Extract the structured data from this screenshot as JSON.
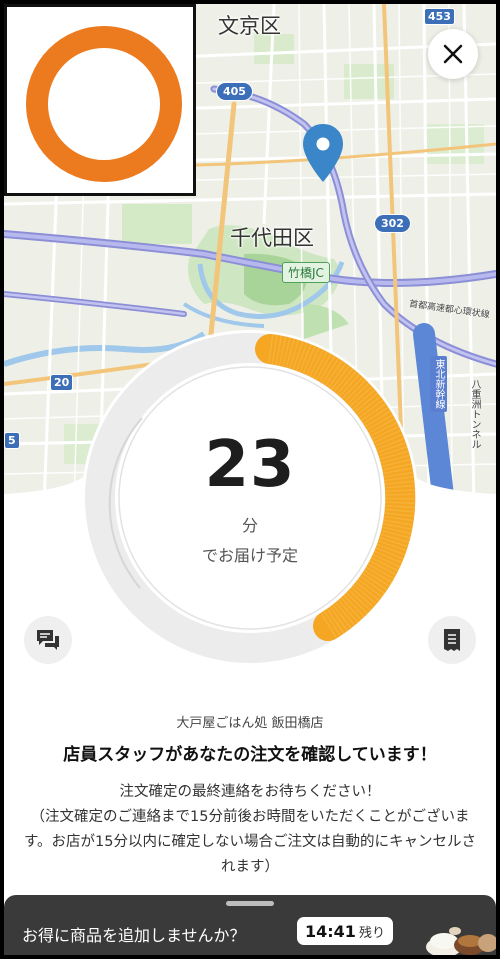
{
  "map": {
    "labels": {
      "bunkyo": "文京区",
      "chiyoda": "千代田区",
      "takebashi_jc": "竹橋JC",
      "shutoko": "首都高速都心環状線",
      "tohoku_shinkansen": "東北新幹線",
      "yaesu_tunnel": "八重洲トンネル"
    },
    "route_badges": {
      "r453": "453",
      "r405": "405",
      "r302": "302",
      "r20": "20",
      "r5": "5"
    },
    "pin_color": "#3a86c8"
  },
  "logo": {
    "color": "#ec7a1e"
  },
  "timer": {
    "value": "23",
    "unit": "分",
    "subtitle": "でお届け予定",
    "progress_color": "#f5a623"
  },
  "restaurant": {
    "name": "大戸屋ごはん処 飯田橋店"
  },
  "status": {
    "headline": "店員スタッフがあなたの注文を確認しています！",
    "message_line1": "注文確定の最終連絡をお待ちください！",
    "message_line2": "（注文確定のご連絡まで15分前後お時間をいただくことがございます。お店が15分以内に確定しない場合ご注文は自動的にキャンセルされます）"
  },
  "promo": {
    "text": "お得に商品を追加しませんか？",
    "time": "14:41",
    "time_suffix": "残り"
  },
  "icons": {
    "close": "close-icon",
    "chat": "chat-icon",
    "receipt": "receipt-icon",
    "pin": "location-pin-icon"
  }
}
